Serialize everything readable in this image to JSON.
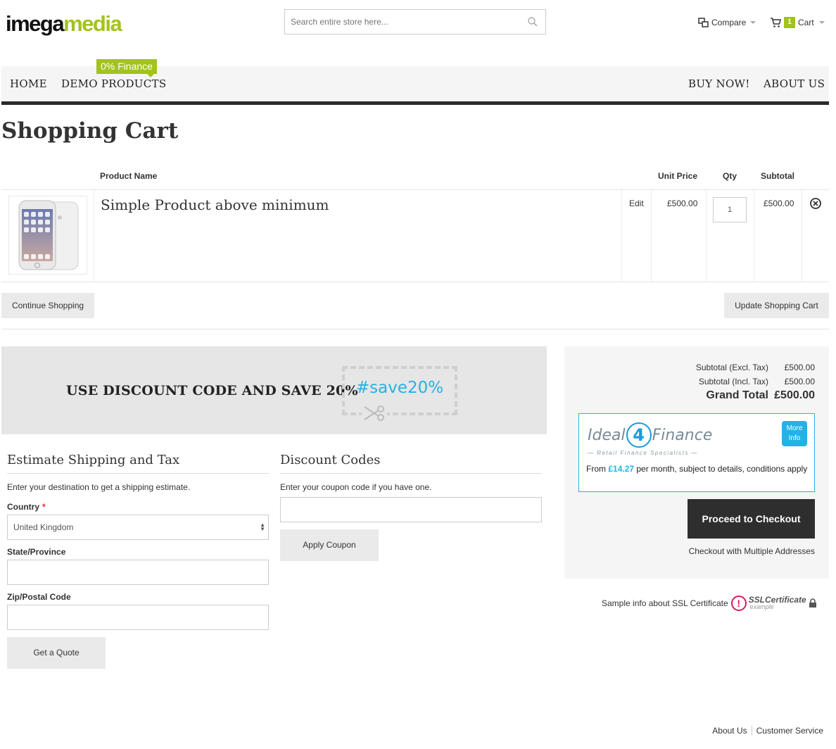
{
  "header": {
    "logo_part1": "imega",
    "logo_part2": "media",
    "search_placeholder": "Search entire store here...",
    "compare_label": "Compare",
    "cart_label": "Cart",
    "cart_count": "1"
  },
  "nav": {
    "items": [
      "HOME",
      "DEMO PRODUCTS",
      "BUY NOW!",
      "ABOUT US"
    ],
    "finance_badge": "0% Finance"
  },
  "page_title": "Shopping Cart",
  "cart_table": {
    "headers": [
      "Product Name",
      "Unit Price",
      "Qty",
      "Subtotal"
    ],
    "rows": [
      {
        "name": "Simple Product above minimum",
        "edit_label": "Edit",
        "unit_price": "£500.00",
        "qty": "1",
        "subtotal": "£500.00"
      }
    ]
  },
  "buttons": {
    "continue": "Continue Shopping",
    "update": "Update Shopping Cart",
    "apply_coupon": "Apply Coupon",
    "get_quote": "Get a Quote",
    "checkout": "Proceed to Checkout",
    "multi_address": "Checkout with Multiple Addresses"
  },
  "banner": {
    "text": "USE DISCOUNT CODE AND SAVE 20%",
    "code": "#save20%"
  },
  "shipping": {
    "title": "Estimate Shipping and Tax",
    "intro": "Enter your destination to get a shipping estimate.",
    "country_label": "Country",
    "required_mark": "*",
    "country_value": "United Kingdom",
    "state_label": "State/Province",
    "zip_label": "Zip/Postal Code"
  },
  "discount": {
    "title": "Discount Codes",
    "intro": "Enter your coupon code if you have one."
  },
  "totals": {
    "subtotal_excl_label": "Subtotal (Excl. Tax)",
    "subtotal_excl_value": "£500.00",
    "subtotal_incl_label": "Subtotal (Incl. Tax)",
    "subtotal_incl_value": "£500.00",
    "grand_label": "Grand Total",
    "grand_value": "£500.00"
  },
  "finance": {
    "logo_left": "Ideal",
    "logo_num": "4",
    "logo_right": "Finance",
    "tagline": "— Retail Finance Specialists —",
    "more_info": "More Info",
    "text_prefix": "From ",
    "amount": "£14.27",
    "text_suffix": " per month, subject to details, conditions apply"
  },
  "ssl": {
    "text": "Sample info about SSL Certificate",
    "badge_title": "SSLCertificate",
    "badge_sub": "example",
    "badge_mark": "!"
  },
  "footer": {
    "links": [
      "About Us",
      "Customer Service"
    ]
  },
  "colors": {
    "brand_green": "#a3c31c",
    "accent_blue": "#22b3e6",
    "dark": "#2e2e2e"
  }
}
